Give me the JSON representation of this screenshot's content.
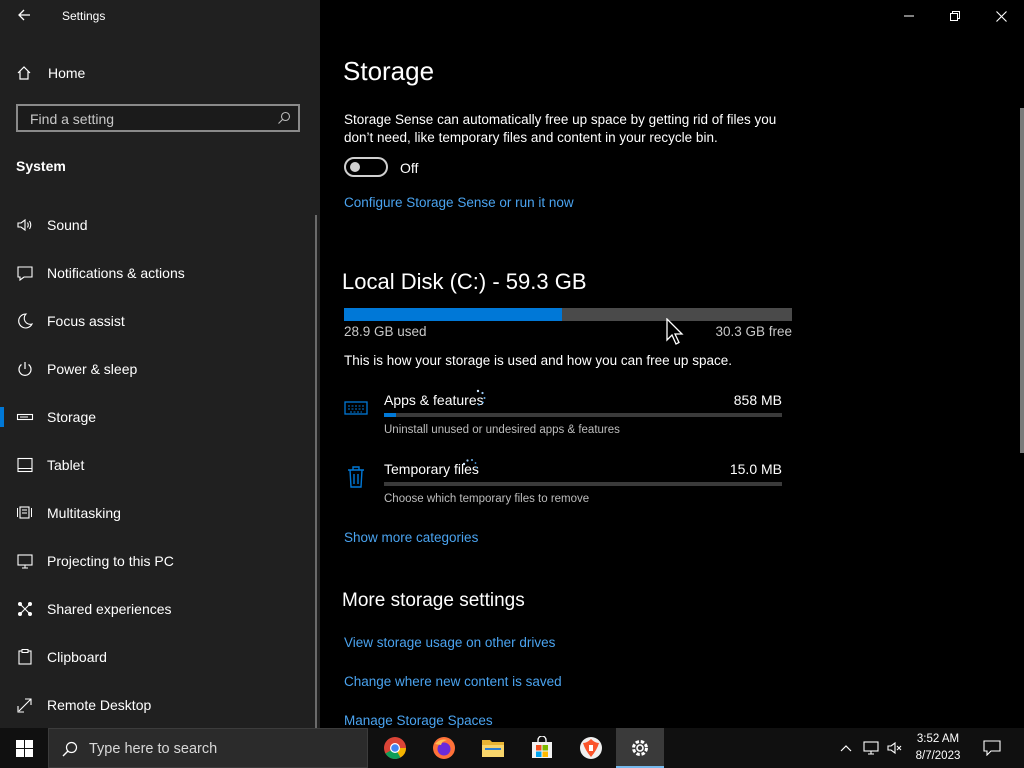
{
  "window": {
    "title": "Settings",
    "back_icon": "arrow-left-icon",
    "controls": [
      "minimize-icon",
      "restore-icon",
      "close-icon"
    ]
  },
  "sidebar": {
    "home_label": "Home",
    "search_placeholder": "Find a setting",
    "section": "System",
    "items": [
      {
        "label": "Sound",
        "icon": "speaker-icon"
      },
      {
        "label": "Notifications & actions",
        "icon": "notification-icon"
      },
      {
        "label": "Focus assist",
        "icon": "moon-icon"
      },
      {
        "label": "Power & sleep",
        "icon": "power-icon"
      },
      {
        "label": "Storage",
        "icon": "storage-icon",
        "selected": true
      },
      {
        "label": "Tablet",
        "icon": "tablet-icon"
      },
      {
        "label": "Multitasking",
        "icon": "multitasking-icon"
      },
      {
        "label": "Projecting to this PC",
        "icon": "projecting-icon"
      },
      {
        "label": "Shared experiences",
        "icon": "shared-experiences-icon"
      },
      {
        "label": "Clipboard",
        "icon": "clipboard-icon"
      },
      {
        "label": "Remote Desktop",
        "icon": "remote-desktop-icon"
      }
    ]
  },
  "main": {
    "title": "Storage",
    "description": "Storage Sense can automatically free up space by getting rid of files you don’t need, like temporary files and content in your recycle bin.",
    "toggle_state": "Off",
    "configure_link": "Configure Storage Sense or run it now",
    "disk": {
      "title": "Local Disk (C:) - 59.3 GB",
      "used": "28.9 GB used",
      "free": "30.3 GB free",
      "used_fraction": 0.487
    },
    "usage_desc": "This is how your storage is used and how you can free up space.",
    "categories": [
      {
        "name": "Apps & features",
        "size": "858 MB",
        "desc": "Uninstall unused or undesired apps & features",
        "icon": "apps-features-icon",
        "fraction": 0.03
      },
      {
        "name": "Temporary files",
        "size": "15.0 MB",
        "desc": "Choose which temporary files to remove",
        "icon": "trash-icon",
        "fraction": 0.0
      }
    ],
    "show_more": "Show more categories",
    "more_title": "More storage settings",
    "links": [
      "View storage usage on other drives",
      "Change where new content is saved",
      "Manage Storage Spaces"
    ]
  },
  "taskbar": {
    "search_text": "Type here to search",
    "apps": [
      "chrome-icon",
      "firefox-icon",
      "file-explorer-icon",
      "microsoft-store-icon",
      "brave-icon",
      "settings-gear-icon"
    ],
    "time": "3:52 AM",
    "date": "8/7/2023"
  },
  "colors": {
    "accent": "#0078d7",
    "link": "#4aa3ef",
    "sidebar_bg": "#202020",
    "main_bg": "#000000"
  }
}
